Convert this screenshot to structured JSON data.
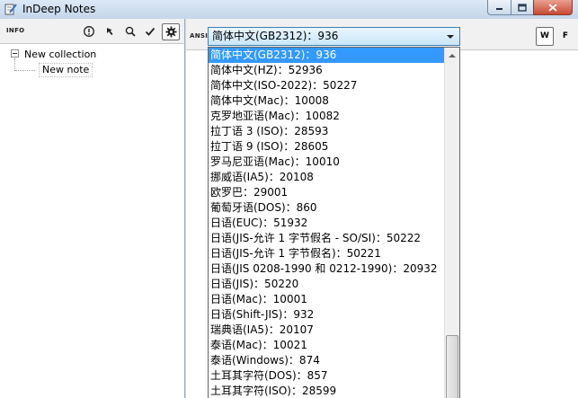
{
  "window": {
    "title": "InDeep Notes",
    "accent": "#3399ff"
  },
  "left_toolbar": {
    "info_label": "INFO",
    "icons": [
      "info-circle-icon",
      "cursor-arrow-icon",
      "magnifier-icon",
      "checkmark-icon",
      "gear-icon"
    ]
  },
  "tree": {
    "collection": "New collection",
    "note": "New note"
  },
  "right_toolbar": {
    "ansi_label": "ANSI",
    "selected_encoding": "简体中文(GB2312)：936",
    "w_label": "W",
    "f_label": "F"
  },
  "encodings": [
    "简体中文(GB2312)：936",
    "简体中文(HZ)：52936",
    "简体中文(ISO-2022)：50227",
    "简体中文(Mac)：10008",
    "克罗地亚语(Mac)：10082",
    "拉丁语 3 (ISO)：28593",
    "拉丁语 9 (ISO)：28605",
    "罗马尼亚语(Mac)：10010",
    "挪威语(IA5)：20108",
    "欧罗巴：29001",
    "葡萄牙语(DOS)：860",
    "日语(EUC)：51932",
    "日语(JIS-允许 1 字节假名 - SO/SI)：50222",
    "日语(JIS-允许 1 字节假名)：50221",
    "日语(JIS 0208-1990 和 0212-1990)：20932",
    "日语(JIS)：50220",
    "日语(Mac)：10001",
    "日语(Shift-JIS)：932",
    "瑞典语(IA5)：20107",
    "泰语(Mac)：10021",
    "泰语(Windows)：874",
    "土耳其字符(DOS)：857",
    "土耳其字符(ISO)：28599"
  ]
}
